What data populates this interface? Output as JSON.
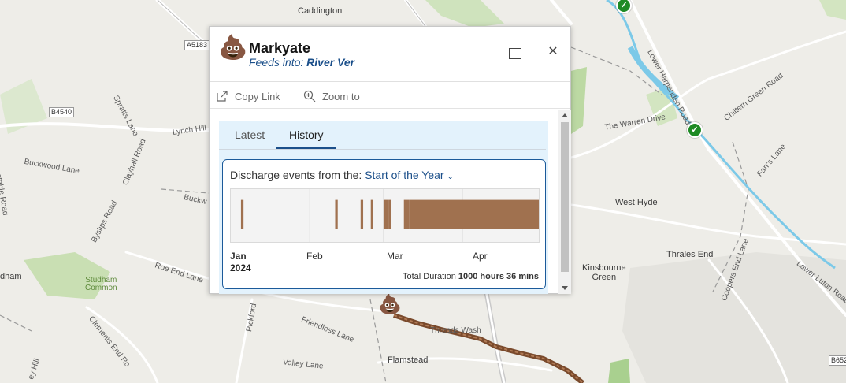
{
  "map": {
    "places": [
      {
        "key": "caddington",
        "text": "Caddington"
      },
      {
        "key": "west_hyde",
        "text": "West Hyde"
      },
      {
        "key": "thrales_end",
        "text": "Thrales End"
      },
      {
        "key": "kinsbourne_green",
        "text": "Kinsbourne\nGreen"
      },
      {
        "key": "flamstead",
        "text": "Flamstead"
      },
      {
        "key": "studham",
        "text": "dham"
      }
    ],
    "roads": [
      {
        "key": "spratts_lane",
        "text": "Spratts Lane"
      },
      {
        "key": "lynch_hill",
        "text": "Lynch Hill"
      },
      {
        "key": "buckwood_lane",
        "text": "Buckwood Lane"
      },
      {
        "key": "clayhall_road",
        "text": "Clayhall Road"
      },
      {
        "key": "byslips_road",
        "text": "Byslips Road"
      },
      {
        "key": "roe_end_lane",
        "text": "Roe End Lane"
      },
      {
        "key": "clements_end",
        "text": "Clements End Ro"
      },
      {
        "key": "friendless_lane",
        "text": "Friendless Lane"
      },
      {
        "key": "valley_lane",
        "text": "Valley Lane"
      },
      {
        "key": "pickford",
        "text": "Pickford"
      },
      {
        "key": "threads_wash",
        "text": "Threads Wash"
      },
      {
        "key": "warren_drive",
        "text": "The Warren Drive"
      },
      {
        "key": "chiltern_green",
        "text": "Chiltern Green Road"
      },
      {
        "key": "farrs_lane",
        "text": "Farr's Lane"
      },
      {
        "key": "lower_harpenden",
        "text": "Lower Harpenden Road"
      },
      {
        "key": "lower_luton",
        "text": "Lower Luton Road"
      },
      {
        "key": "coopers_end",
        "text": "Coopers End Lane"
      },
      {
        "key": "valley_hill",
        "text": "ey Hill"
      },
      {
        "key": "stable_road",
        "text": "stable Road"
      },
      {
        "key": "buckw",
        "text": "Buckw"
      }
    ],
    "green_labels": {
      "studham_common": "Studham\nCommon"
    },
    "shields": {
      "a5183": "A5183",
      "b4540": "B4540",
      "b652": "B652"
    }
  },
  "popup": {
    "icon": "poo-icon",
    "title": "Markyate",
    "feeds_prefix": "Feeds into: ",
    "feeds_river": "River Ver",
    "actions": {
      "copy_link": "Copy Link",
      "zoom_to": "Zoom to"
    },
    "tabs": [
      {
        "label": "Latest",
        "active": false
      },
      {
        "label": "History",
        "active": true
      }
    ],
    "history": {
      "heading_prefix": "Discharge events from the: ",
      "range_selected": "Start of the Year",
      "months": [
        "Jan",
        "Feb",
        "Mar",
        "Apr"
      ],
      "year": "2024",
      "total_prefix": "Total Duration ",
      "total_value": "1000 hours 36 mins",
      "event_color": "#a0714f",
      "timeline_start": "2024-01-01",
      "timeline_end": "2024-04-30",
      "events": [
        {
          "start": "2024-01-05",
          "end": "2024-01-05"
        },
        {
          "start": "2024-02-11",
          "end": "2024-02-11"
        },
        {
          "start": "2024-02-21",
          "end": "2024-02-21"
        },
        {
          "start": "2024-02-25",
          "end": "2024-02-25"
        },
        {
          "start": "2024-03-01",
          "end": "2024-03-02"
        },
        {
          "start": "2024-03-03",
          "end": "2024-03-03"
        },
        {
          "start": "2024-03-09",
          "end": "2024-03-09"
        },
        {
          "start": "2024-03-10",
          "end": "2024-03-10"
        },
        {
          "start": "2024-03-11",
          "end": "2024-04-30"
        }
      ]
    }
  },
  "colors": {
    "accent": "#1b4f8a",
    "river": "#7cc9e8",
    "status_ok": "#1e8a24",
    "sewage_line": "#7a4a2c"
  }
}
